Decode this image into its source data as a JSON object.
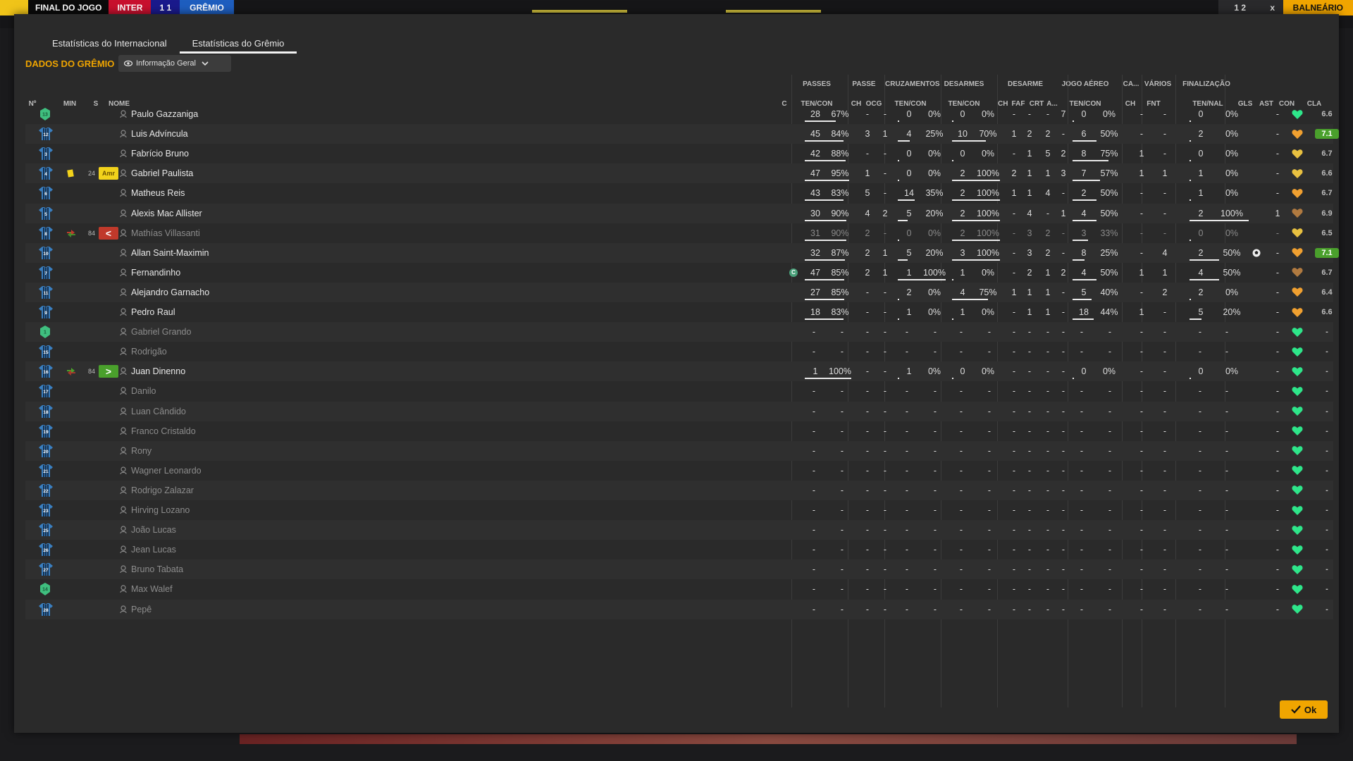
{
  "topbar": {
    "match_status": "FINAL DO JOGO",
    "home_team": "INTER",
    "score": "1 1",
    "away_team": "GRÊMIO",
    "right_score": "1 2",
    "right_x": "x",
    "locker_room": "BALNEÁRIO"
  },
  "tabs": [
    "Estatísticas do Internacional",
    "Estatísticas do Grêmio"
  ],
  "section_title": "DADOS DO GRÊMIO",
  "view_selector": {
    "label": "Informação Geral",
    "icon": "eye-icon"
  },
  "ok_label": "Ok",
  "group_headers": {
    "passes": "PASSES",
    "passe": "PASSE",
    "cruzamentos": "CRUZAMENTOS",
    "desarmes": "DESARMES",
    "desarme": "DESARME",
    "jogo_aereo": "JOGO AÉREO",
    "ca": "CA...",
    "varios": "VÁRIOS",
    "finalizacao": "FINALIZAÇÃO"
  },
  "column_headers": {
    "num": "Nº",
    "min": "MIN",
    "s": "S",
    "nome": "NOME",
    "c": "C",
    "passes": "TEN/CON",
    "passe_ch": "CH",
    "passe_ocg": "OCG",
    "cruz": "TEN/CON",
    "des": "TEN/CON",
    "d_ch": "CH",
    "d_faf": "FAF",
    "d_crt": "CRT",
    "d_a": "A...",
    "aereo": "TEN/CON",
    "ca_ch": "CH",
    "fnt": "FNT",
    "fin": "TEN/NAL",
    "gls": "GLS",
    "ast": "AST",
    "con": "CON",
    "cla": "CLA"
  },
  "players": [
    {
      "num": "13",
      "gk": true,
      "name": "Paulo Gazzaniga",
      "pas": [
        "28",
        "67%"
      ],
      "pch": "-",
      "ocg": "-",
      "cru": [
        "0",
        "0%"
      ],
      "des": [
        "0",
        "0%"
      ],
      "dch": "-",
      "faf": "-",
      "crt": "-",
      "da": "7",
      "aer": [
        "0",
        "0%"
      ],
      "cach": "-",
      "fnt": "-",
      "fin": [
        "0",
        "0%"
      ],
      "gls": "",
      "ast": "-",
      "con": "green",
      "cla": "6.6"
    },
    {
      "num": "12",
      "name": "Luis Advíncula",
      "pas": [
        "45",
        "84%"
      ],
      "pch": "3",
      "ocg": "1",
      "cru": [
        "4",
        "25%"
      ],
      "des": [
        "10",
        "70%"
      ],
      "dch": "1",
      "faf": "2",
      "crt": "2",
      "da": "-",
      "aer": [
        "6",
        "50%"
      ],
      "cach": "-",
      "fnt": "-",
      "fin": [
        "2",
        "0%"
      ],
      "gls": "",
      "ast": "-",
      "con": "orange",
      "cla": "7.1",
      "clagreen": true
    },
    {
      "num": "3",
      "name": "Fabrício Bruno",
      "pas": [
        "42",
        "88%"
      ],
      "pch": "-",
      "ocg": "-",
      "cru": [
        "0",
        "0%"
      ],
      "des": [
        "0",
        "0%"
      ],
      "dch": "-",
      "faf": "1",
      "crt": "5",
      "da": "2",
      "aer": [
        "8",
        "75%"
      ],
      "cach": "1",
      "fnt": "-",
      "fin": [
        "0",
        "0%"
      ],
      "gls": "",
      "ast": "-",
      "con": "yellow",
      "cla": "6.7"
    },
    {
      "num": "4",
      "min": "24",
      "yellow": true,
      "badge": "Amr",
      "name": "Gabriel Paulista",
      "pas": [
        "47",
        "95%"
      ],
      "pch": "1",
      "ocg": "-",
      "cru": [
        "0",
        "0%"
      ],
      "des": [
        "2",
        "100%"
      ],
      "dch": "2",
      "faf": "1",
      "crt": "1",
      "da": "3",
      "aer": [
        "7",
        "57%"
      ],
      "cach": "1",
      "fnt": "1",
      "fin": [
        "1",
        "0%"
      ],
      "gls": "",
      "ast": "-",
      "con": "yellow",
      "cla": "6.6"
    },
    {
      "num": "6",
      "name": "Matheus Reis",
      "pas": [
        "43",
        "83%"
      ],
      "pch": "5",
      "ocg": "-",
      "cru": [
        "14",
        "35%"
      ],
      "des": [
        "2",
        "100%"
      ],
      "dch": "1",
      "faf": "1",
      "crt": "4",
      "da": "-",
      "aer": [
        "2",
        "50%"
      ],
      "cach": "-",
      "fnt": "-",
      "fin": [
        "1",
        "0%"
      ],
      "gls": "",
      "ast": "-",
      "con": "orange",
      "cla": "6.7"
    },
    {
      "num": "5",
      "name": "Alexis Mac Allister",
      "pas": [
        "30",
        "90%"
      ],
      "pch": "4",
      "ocg": "2",
      "cru": [
        "5",
        "20%"
      ],
      "des": [
        "2",
        "100%"
      ],
      "dch": "-",
      "faf": "4",
      "crt": "-",
      "da": "1",
      "aer": [
        "4",
        "50%"
      ],
      "cach": "-",
      "fnt": "-",
      "fin": [
        "2",
        "100%"
      ],
      "gls": "",
      "ast": "1",
      "con": "brown",
      "cla": "6.9"
    },
    {
      "num": "8",
      "min": "84",
      "subout": true,
      "badge": "<",
      "name": "Mathías Villasanti",
      "dim": true,
      "pas": [
        "31",
        "90%"
      ],
      "pch": "2",
      "ocg": "-",
      "cru": [
        "0",
        "0%"
      ],
      "des": [
        "2",
        "100%"
      ],
      "dch": "-",
      "faf": "3",
      "crt": "2",
      "da": "-",
      "aer": [
        "3",
        "33%"
      ],
      "cach": "-",
      "fnt": "-",
      "fin": [
        "0",
        "0%"
      ],
      "gls": "",
      "ast": "-",
      "con": "yellow",
      "cla": "6.5"
    },
    {
      "num": "10",
      "name": "Allan Saint-Maximin",
      "pas": [
        "32",
        "87%"
      ],
      "pch": "2",
      "ocg": "1",
      "cru": [
        "5",
        "20%"
      ],
      "des": [
        "3",
        "100%"
      ],
      "dch": "-",
      "faf": "3",
      "crt": "2",
      "da": "-",
      "aer": [
        "8",
        "25%"
      ],
      "cach": "-",
      "fnt": "4",
      "fin": [
        "2",
        "50%"
      ],
      "gls": "ball",
      "ast": "-",
      "con": "orange",
      "cla": "7.1",
      "clagreen": true
    },
    {
      "num": "7",
      "captain": "C",
      "name": "Fernandinho",
      "pas": [
        "47",
        "85%"
      ],
      "pch": "2",
      "ocg": "1",
      "cru": [
        "1",
        "100%"
      ],
      "des": [
        "1",
        "0%"
      ],
      "dch": "-",
      "faf": "2",
      "crt": "1",
      "da": "2",
      "aer": [
        "4",
        "50%"
      ],
      "cach": "1",
      "fnt": "1",
      "fin": [
        "4",
        "50%"
      ],
      "gls": "",
      "ast": "-",
      "con": "brown",
      "cla": "6.7"
    },
    {
      "num": "11",
      "name": "Alejandro Garnacho",
      "pas": [
        "27",
        "85%"
      ],
      "pch": "-",
      "ocg": "-",
      "cru": [
        "2",
        "0%"
      ],
      "des": [
        "4",
        "75%"
      ],
      "dch": "1",
      "faf": "1",
      "crt": "1",
      "da": "-",
      "aer": [
        "5",
        "40%"
      ],
      "cach": "-",
      "fnt": "2",
      "fin": [
        "2",
        "0%"
      ],
      "gls": "",
      "ast": "-",
      "con": "orange",
      "cla": "6.4"
    },
    {
      "num": "9",
      "name": "Pedro Raul",
      "pas": [
        "18",
        "83%"
      ],
      "pch": "-",
      "ocg": "-",
      "cru": [
        "1",
        "0%"
      ],
      "des": [
        "1",
        "0%"
      ],
      "dch": "-",
      "faf": "1",
      "crt": "1",
      "da": "-",
      "aer": [
        "18",
        "44%"
      ],
      "cach": "1",
      "fnt": "-",
      "fin": [
        "5",
        "20%"
      ],
      "gls": "",
      "ast": "-",
      "con": "orange",
      "cla": "6.6"
    },
    {
      "num": "1",
      "gk": true,
      "name": "Gabriel Grando",
      "dim": true,
      "empty": true,
      "con": "green"
    },
    {
      "num": "15",
      "name": "Rodrigão",
      "dim": true,
      "empty": true,
      "con": "green"
    },
    {
      "num": "16",
      "min": "84",
      "subin": true,
      "badge": ">",
      "name": "Juan Dinenno",
      "pas": [
        "1",
        "100%"
      ],
      "pch": "-",
      "ocg": "-",
      "cru": [
        "1",
        "0%"
      ],
      "des": [
        "0",
        "0%"
      ],
      "dch": "-",
      "faf": "-",
      "crt": "-",
      "da": "-",
      "aer": [
        "0",
        "0%"
      ],
      "cach": "-",
      "fnt": "-",
      "fin": [
        "0",
        "0%"
      ],
      "gls": "",
      "ast": "-",
      "con": "green",
      "cla": "-"
    },
    {
      "num": "17",
      "name": "Danilo",
      "dim": true,
      "empty": true,
      "con": "green"
    },
    {
      "num": "18",
      "name": "Luan Cândido",
      "dim": true,
      "empty": true,
      "con": "green"
    },
    {
      "num": "19",
      "name": "Franco Cristaldo",
      "dim": true,
      "empty": true,
      "con": "green"
    },
    {
      "num": "20",
      "name": "Rony",
      "dim": true,
      "empty": true,
      "con": "green"
    },
    {
      "num": "21",
      "name": "Wagner Leonardo",
      "dim": true,
      "empty": true,
      "con": "green"
    },
    {
      "num": "22",
      "name": "Rodrigo Zalazar",
      "dim": true,
      "empty": true,
      "con": "green"
    },
    {
      "num": "23",
      "name": "Hirving Lozano",
      "dim": true,
      "empty": true,
      "con": "green"
    },
    {
      "num": "25",
      "name": "João Lucas",
      "dim": true,
      "empty": true,
      "con": "green"
    },
    {
      "num": "26",
      "name": "Jean Lucas",
      "dim": true,
      "empty": true,
      "con": "green"
    },
    {
      "num": "27",
      "name": "Bruno Tabata",
      "dim": true,
      "empty": true,
      "con": "green"
    },
    {
      "num": "14",
      "gk": true,
      "name": "Max Walef",
      "dim": true,
      "empty": true,
      "con": "green"
    },
    {
      "num": "28",
      "name": "Pepê",
      "dim": true,
      "empty": true,
      "con": "green"
    }
  ],
  "colors": {
    "accent": "#f0a500",
    "rating_green": "#4aa02c",
    "gk_green": "#3fbf7f",
    "heart_green": "#2ee68a",
    "heart_orange": "#f0a030",
    "heart_yellow": "#e8c040",
    "heart_brown": "#b07a40",
    "yellow_card": "#f2d21b",
    "sub_out": "#c0392b",
    "sub_in": "#4aa02c"
  }
}
